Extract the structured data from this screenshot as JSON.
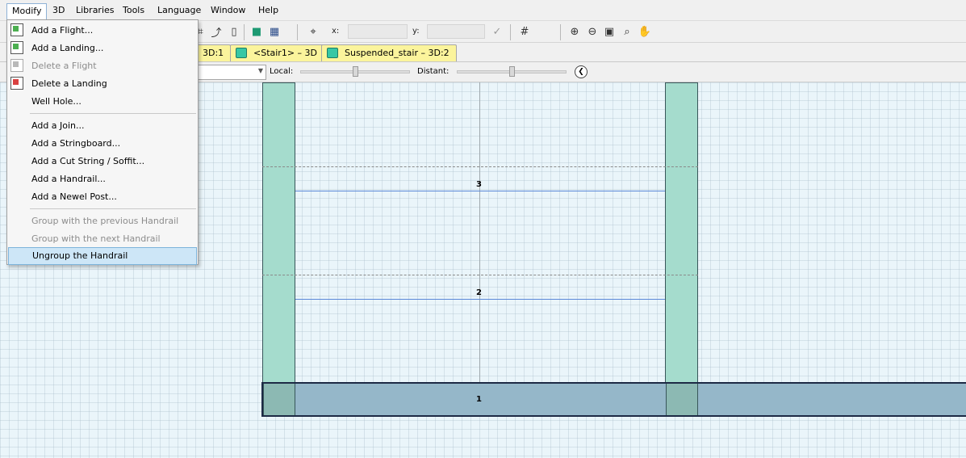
{
  "menubar": {
    "items": [
      "Modify",
      "3D",
      "Libraries",
      "Tools",
      "Language",
      "Window",
      "Help"
    ]
  },
  "toolbar": {
    "x_label": "x:",
    "y_label": "y:",
    "x_value": "",
    "y_value": ""
  },
  "tabs": [
    {
      "label": "3D:1"
    },
    {
      "label": "<Stair1> – 3D"
    },
    {
      "label": "Suspended_stair – 3D:2"
    }
  ],
  "options": {
    "local_label": "Local:",
    "distant_label": "Distant:"
  },
  "drawing": {
    "steps": [
      "1",
      "2",
      "3"
    ],
    "colors": {
      "stringer": "#a5dccd",
      "step_line": "#5b88d8",
      "band": "#95b7c9"
    }
  },
  "modify_menu": {
    "group1": [
      {
        "label": "Add a Flight...",
        "enabled": true,
        "icon": "flight-icon"
      },
      {
        "label": "Add a Landing...",
        "enabled": true,
        "icon": "landing-icon"
      },
      {
        "label": "Delete a Flight",
        "enabled": false,
        "icon": "delete-flight-icon"
      },
      {
        "label": "Delete a Landing",
        "enabled": true,
        "icon": "delete-landing-icon"
      },
      {
        "label": "Well Hole...",
        "enabled": true
      }
    ],
    "group2": [
      {
        "label": "Add a Join...",
        "enabled": true
      },
      {
        "label": "Add a Stringboard...",
        "enabled": true
      },
      {
        "label": "Add a Cut String / Soffit...",
        "enabled": true
      },
      {
        "label": "Add a Handrail...",
        "enabled": true
      },
      {
        "label": "Add a Newel Post...",
        "enabled": true
      }
    ],
    "group3": [
      {
        "label": "Group with the previous Handrail",
        "enabled": false
      },
      {
        "label": "Group with the next Handrail",
        "enabled": false
      },
      {
        "label": "Ungroup the Handrail",
        "enabled": true,
        "highlighted": true
      }
    ]
  }
}
